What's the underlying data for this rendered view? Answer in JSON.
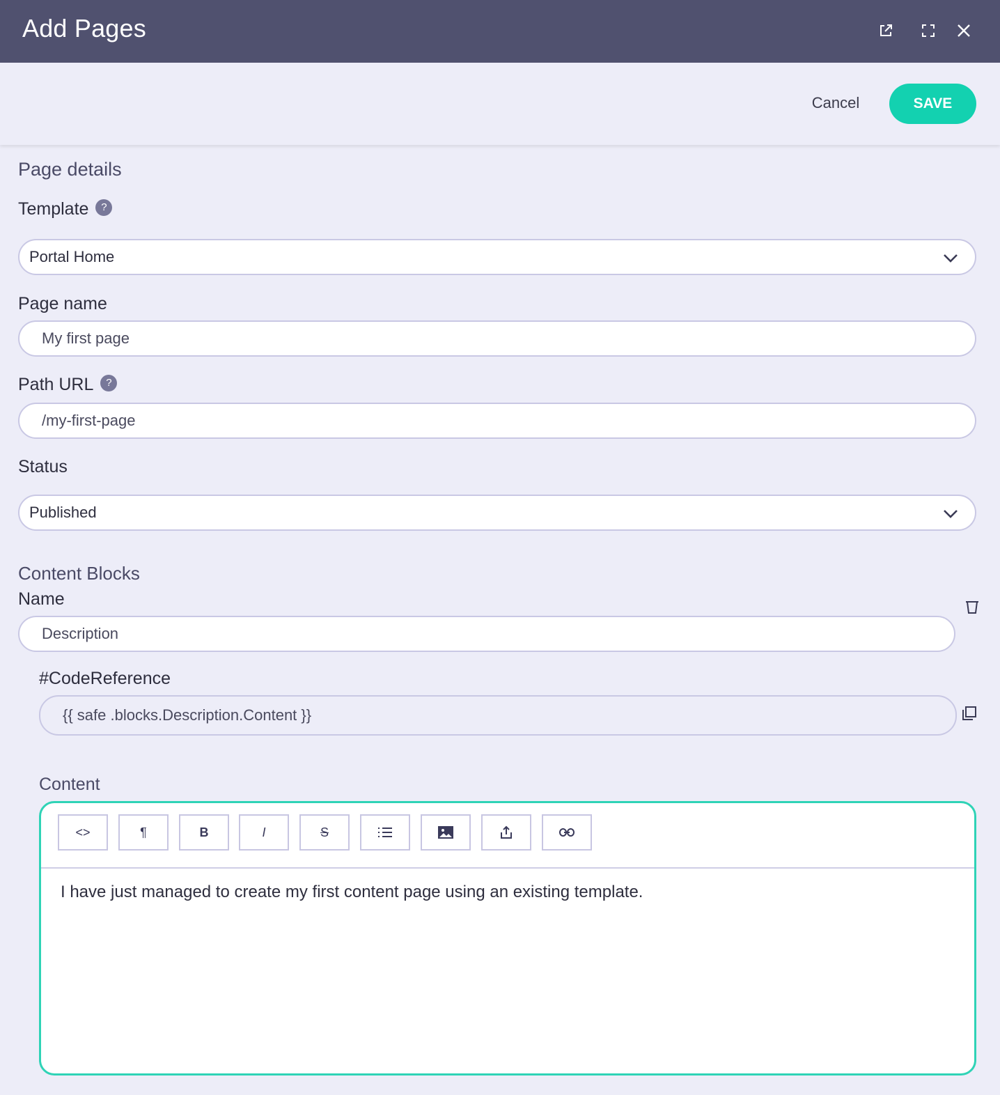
{
  "window": {
    "title": "Add Pages",
    "icons": [
      "external-link-icon",
      "fullscreen-icon",
      "close-icon"
    ]
  },
  "actions": {
    "cancel_label": "Cancel",
    "save_label": "SAVE",
    "save_color": "#13d1b0"
  },
  "page_details": {
    "section_title": "Page details",
    "template": {
      "label": "Template",
      "value": "Portal Home"
    },
    "page_name": {
      "label": "Page name",
      "value": "My first page"
    },
    "path_url": {
      "label": "Path URL",
      "value": "/my-first-page"
    },
    "status": {
      "label": "Status",
      "value": "Published"
    }
  },
  "content_blocks": {
    "section_title": "Content Blocks",
    "name": {
      "label": "Name",
      "value": "Description"
    },
    "code_reference": {
      "label": "#CodeReference",
      "value": "{{ safe .blocks.Description.Content }}"
    },
    "content": {
      "label": "Content",
      "toolbar": [
        "<>",
        "¶",
        "B",
        "I",
        "S",
        "list-icon",
        "image-icon",
        "upload-icon",
        "link-icon"
      ],
      "text": "I have just managed to create my first content page using an existing template."
    }
  },
  "colors": {
    "titlebar": "#50516f",
    "background": "#ededf8",
    "accent": "#13d1b0"
  }
}
